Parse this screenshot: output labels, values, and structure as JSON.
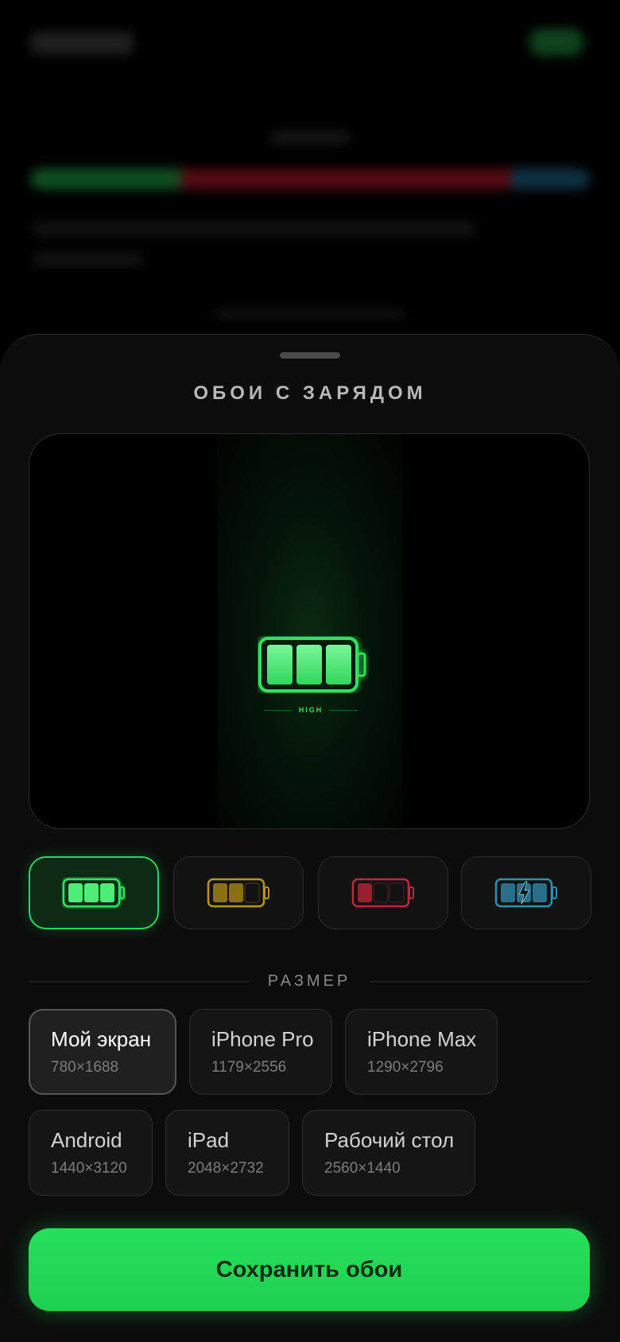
{
  "sheet": {
    "title": "ОБОИ С ЗАРЯДОМ",
    "preview": {
      "battery_level": "high",
      "battery_cells": 3,
      "level_label": "HIGH",
      "accent": "#2ee25c"
    },
    "styles": [
      {
        "id": "high",
        "icon": "battery-full-icon",
        "color": "#2ee25c",
        "selected": true
      },
      {
        "id": "medium",
        "icon": "battery-medium-icon",
        "color": "#b8941a",
        "selected": false
      },
      {
        "id": "low",
        "icon": "battery-low-icon",
        "color": "#c0283a",
        "selected": false
      },
      {
        "id": "charging",
        "icon": "battery-charging-icon",
        "color": "#2f8fb0",
        "selected": false
      }
    ],
    "size_section_label": "РАЗМЕР",
    "sizes": [
      {
        "name": "Мой экран",
        "dims": "780×1688",
        "selected": true
      },
      {
        "name": "iPhone Pro",
        "dims": "1179×2556",
        "selected": false
      },
      {
        "name": "iPhone Max",
        "dims": "1290×2796",
        "selected": false
      },
      {
        "name": "Android",
        "dims": "1440×3120",
        "selected": false
      },
      {
        "name": "iPad",
        "dims": "2048×2732",
        "selected": false
      },
      {
        "name": "Рабочий стол",
        "dims": "2560×1440",
        "selected": false
      }
    ],
    "save_label": "Сохранить обои"
  },
  "colors": {
    "accent_green": "#22dc5a",
    "background": "#000000",
    "sheet_background": "#0c0c0c"
  }
}
